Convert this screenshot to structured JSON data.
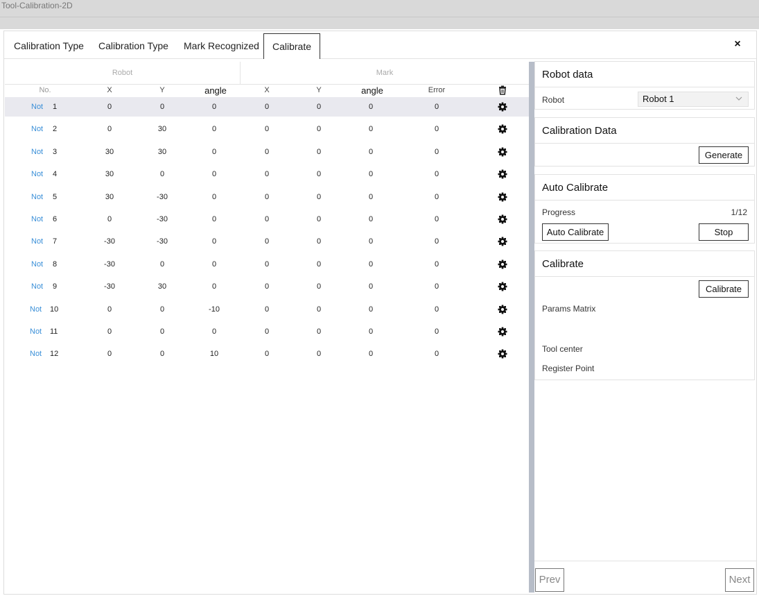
{
  "window": {
    "title": "Tool-Calibration-2D"
  },
  "tabs": [
    {
      "label": "Calibration Type"
    },
    {
      "label": "Calibration Type"
    },
    {
      "label": "Mark Recognized"
    },
    {
      "label": "Calibrate"
    }
  ],
  "active_tab": 3,
  "close_icon": "×",
  "table": {
    "group_robot": "Robot",
    "group_mark": "Mark",
    "headers": {
      "no": "No.",
      "rx": "X",
      "ry": "Y",
      "rangle": "angle",
      "mx": "X",
      "my": "Y",
      "mangle": "angle",
      "error": "Error"
    },
    "rows": [
      {
        "status": "Not",
        "no": "1",
        "rx": "0",
        "ry": "0",
        "rangle": "0",
        "mx": "0",
        "my": "0",
        "mangle": "0",
        "error": "0"
      },
      {
        "status": "Not",
        "no": "2",
        "rx": "0",
        "ry": "30",
        "rangle": "0",
        "mx": "0",
        "my": "0",
        "mangle": "0",
        "error": "0"
      },
      {
        "status": "Not",
        "no": "3",
        "rx": "30",
        "ry": "30",
        "rangle": "0",
        "mx": "0",
        "my": "0",
        "mangle": "0",
        "error": "0"
      },
      {
        "status": "Not",
        "no": "4",
        "rx": "30",
        "ry": "0",
        "rangle": "0",
        "mx": "0",
        "my": "0",
        "mangle": "0",
        "error": "0"
      },
      {
        "status": "Not",
        "no": "5",
        "rx": "30",
        "ry": "-30",
        "rangle": "0",
        "mx": "0",
        "my": "0",
        "mangle": "0",
        "error": "0"
      },
      {
        "status": "Not",
        "no": "6",
        "rx": "0",
        "ry": "-30",
        "rangle": "0",
        "mx": "0",
        "my": "0",
        "mangle": "0",
        "error": "0"
      },
      {
        "status": "Not",
        "no": "7",
        "rx": "-30",
        "ry": "-30",
        "rangle": "0",
        "mx": "0",
        "my": "0",
        "mangle": "0",
        "error": "0"
      },
      {
        "status": "Not",
        "no": "8",
        "rx": "-30",
        "ry": "0",
        "rangle": "0",
        "mx": "0",
        "my": "0",
        "mangle": "0",
        "error": "0"
      },
      {
        "status": "Not",
        "no": "9",
        "rx": "-30",
        "ry": "30",
        "rangle": "0",
        "mx": "0",
        "my": "0",
        "mangle": "0",
        "error": "0"
      },
      {
        "status": "Not",
        "no": "10",
        "rx": "0",
        "ry": "0",
        "rangle": "-10",
        "mx": "0",
        "my": "0",
        "mangle": "0",
        "error": "0"
      },
      {
        "status": "Not",
        "no": "11",
        "rx": "0",
        "ry": "0",
        "rangle": "0",
        "mx": "0",
        "my": "0",
        "mangle": "0",
        "error": "0"
      },
      {
        "status": "Not",
        "no": "12",
        "rx": "0",
        "ry": "0",
        "rangle": "10",
        "mx": "0",
        "my": "0",
        "mangle": "0",
        "error": "0"
      }
    ],
    "selected_row": 0
  },
  "robot_data": {
    "title": "Robot data",
    "robot_label": "Robot",
    "robot_value": "Robot 1"
  },
  "calibration_data": {
    "title": "Calibration Data",
    "generate_label": "Generate"
  },
  "auto_calibrate": {
    "title": "Auto Calibrate",
    "progress_label": "Progress",
    "progress_value": "1/12",
    "auto_label": "Auto Calibrate",
    "stop_label": "Stop"
  },
  "calibrate": {
    "title": "Calibrate",
    "calibrate_label": "Calibrate",
    "params_label": "Params Matrix",
    "tool_center_label": "Tool center",
    "register_label": "Register Point"
  },
  "footer": {
    "prev_label": "Prev",
    "next_label": "Next"
  }
}
